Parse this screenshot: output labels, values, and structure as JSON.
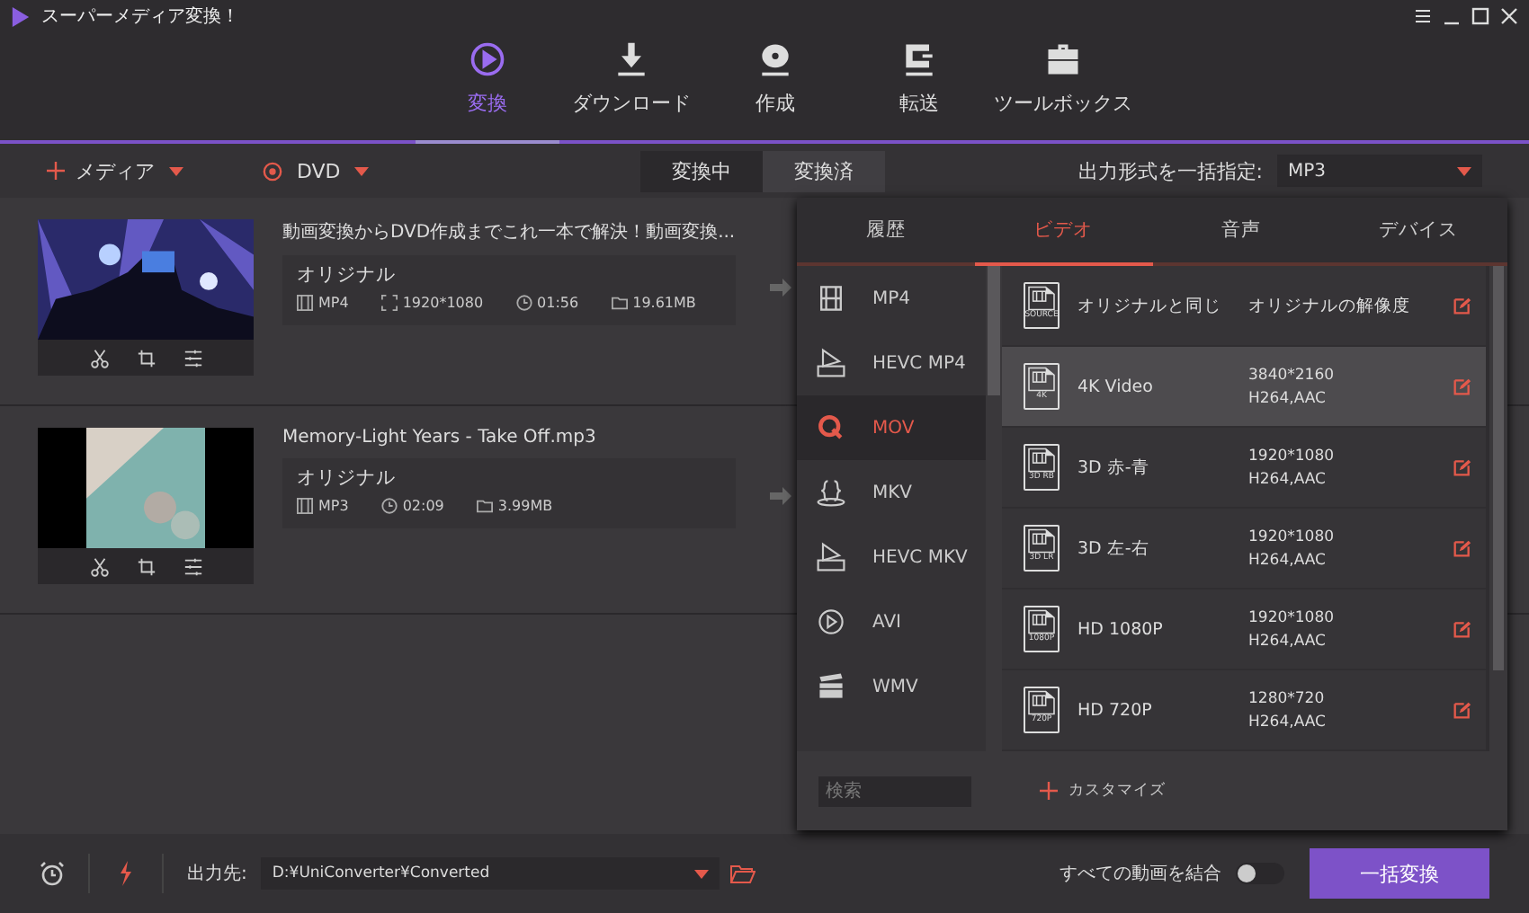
{
  "app": {
    "title": "スーパーメディア変換！"
  },
  "nav": [
    {
      "label": "変換",
      "selected": true
    },
    {
      "label": "ダウンロード",
      "selected": false
    },
    {
      "label": "作成",
      "selected": false
    },
    {
      "label": "転送",
      "selected": false
    },
    {
      "label": "ツールボックス",
      "selected": false
    }
  ],
  "toolbar": {
    "add_media": "メディア",
    "dvd": "DVD",
    "tabs": [
      {
        "label": "変換中",
        "selected": true
      },
      {
        "label": "変換済",
        "selected": false
      }
    ],
    "output_format_label": "出力形式を一括指定:",
    "output_format": "MP3"
  },
  "files": [
    {
      "name": "動画変換からDVD作成までこれ一本で解決！動画変換...",
      "preset": "オリジナル",
      "format": "MP4",
      "resolution": "1920*1080",
      "duration": "01:56",
      "size": "19.61MB"
    },
    {
      "name": "Memory-Light Years - Take Off.mp3",
      "preset": "オリジナル",
      "format": "MP3",
      "duration": "02:09",
      "size": "3.99MB"
    }
  ],
  "format_panel": {
    "tabs": [
      {
        "label": "履歴",
        "selected": false
      },
      {
        "label": "ビデオ",
        "selected": true
      },
      {
        "label": "音声",
        "selected": false
      },
      {
        "label": "デバイス",
        "selected": false
      }
    ],
    "categories": [
      {
        "label": "MP4",
        "selected": false
      },
      {
        "label": "HEVC MP4",
        "selected": false
      },
      {
        "label": "MOV",
        "selected": true
      },
      {
        "label": "MKV",
        "selected": false
      },
      {
        "label": "HEVC MKV",
        "selected": false
      },
      {
        "label": "AVI",
        "selected": false
      },
      {
        "label": "WMV",
        "selected": false
      }
    ],
    "presets": [
      {
        "name": "オリジナルと同じ",
        "badge": "SOURCE",
        "detail": "オリジナルの解像度",
        "selected": false
      },
      {
        "name": "4K Video",
        "badge": "4K",
        "resolution": "3840*2160",
        "codec": "H264,AAC",
        "selected": true
      },
      {
        "name": "3D 赤-青",
        "badge": "3D RB",
        "resolution": "1920*1080",
        "codec": "H264,AAC",
        "selected": false
      },
      {
        "name": "3D 左-右",
        "badge": "3D LR",
        "resolution": "1920*1080",
        "codec": "H264,AAC",
        "selected": false
      },
      {
        "name": "HD 1080P",
        "badge": "1080P",
        "resolution": "1920*1080",
        "codec": "H264,AAC",
        "selected": false
      },
      {
        "name": "HD 720P",
        "badge": "720P",
        "resolution": "1280*720",
        "codec": "H264,AAC",
        "selected": false
      }
    ],
    "search": {
      "placeholder": "検索"
    },
    "customize": "カスタマイズ"
  },
  "bottom": {
    "output_label": "出力先:",
    "output_path": "D:¥UniConverter¥Converted",
    "merge_label": "すべての動画を結合",
    "merge_on": false,
    "convert_button": "一括変換"
  }
}
